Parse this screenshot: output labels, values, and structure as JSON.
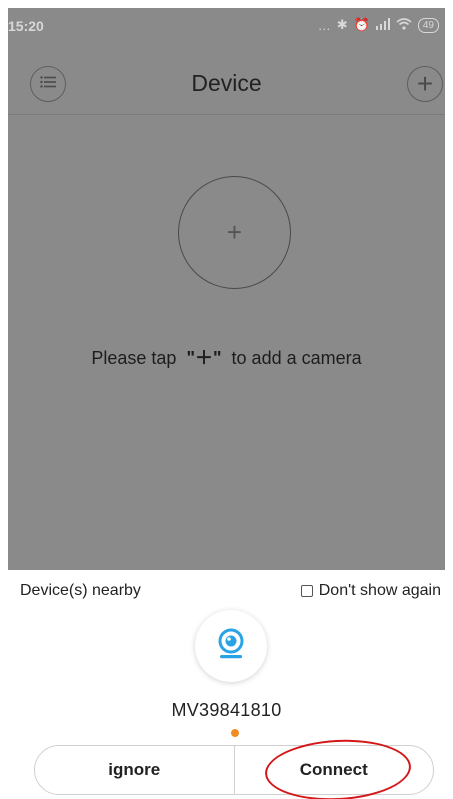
{
  "status_bar": {
    "time": "15:20",
    "icons": [
      "more-dots-icon",
      "bluetooth-icon",
      "alarm-icon",
      "signal-icon",
      "wifi-icon"
    ],
    "battery": "49"
  },
  "header": {
    "title": "Device",
    "menu_icon": "list-icon",
    "add_icon": "plus-icon"
  },
  "empty_state": {
    "add_icon": "plus-icon",
    "message_before": "Please tap",
    "message_symbol": "\"＋\"",
    "message_after": "to add a camera"
  },
  "nearby_sheet": {
    "title": "Device(s) nearby",
    "dont_show_again": "Don't show again",
    "device": {
      "name": "MV39841810",
      "icon": "camera-icon",
      "status_color": "#f08c26"
    },
    "ignore_label": "ignore",
    "connect_label": "Connect",
    "annotation_color": "#d4181b"
  }
}
